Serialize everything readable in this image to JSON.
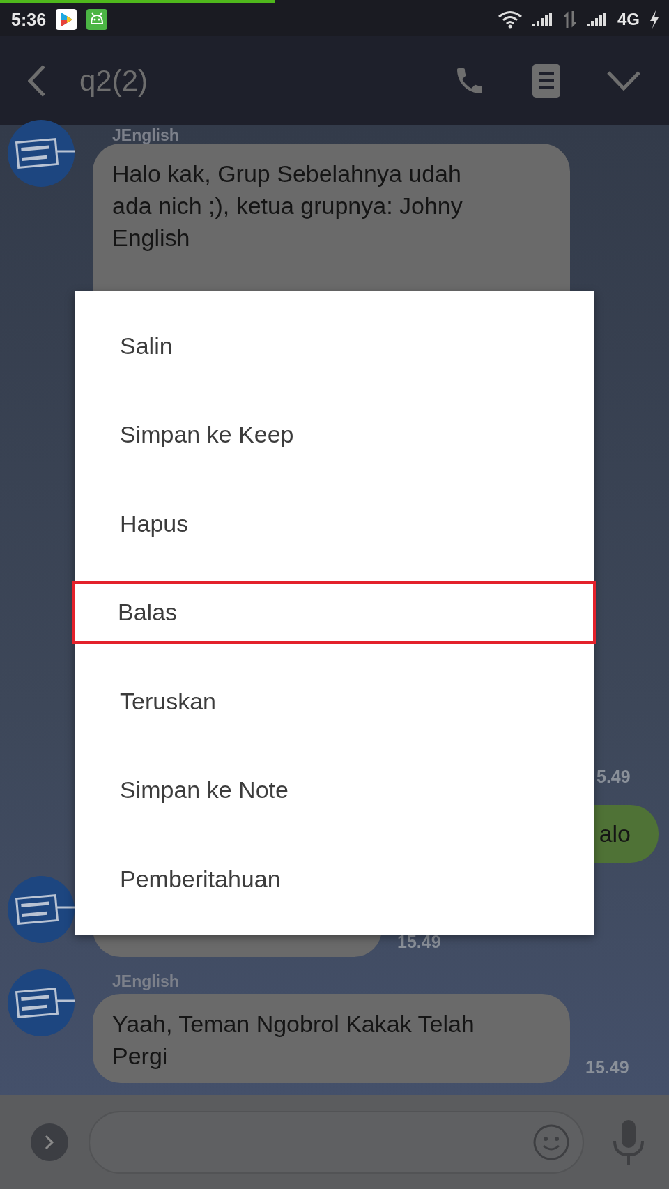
{
  "progress": {
    "level": 0.41
  },
  "status_bar": {
    "time": "5:36",
    "network": "4G"
  },
  "header": {
    "title": "q2(2)"
  },
  "chat": [
    {
      "kind": "incoming",
      "sender": "JEnglish",
      "text": "Halo kak, Grup Sebelahnya udah ada nich ;), ketua grupnya: Johny English"
    },
    {
      "kind": "time",
      "time": "5.49"
    },
    {
      "kind": "outgoing",
      "text": "alo"
    },
    {
      "kind": "covered",
      "time": "15.49"
    },
    {
      "kind": "incoming",
      "sender": "JEnglish",
      "text": "Yaah, Teman Ngobrol Kakak Telah Pergi",
      "time": "15.49"
    }
  ],
  "menu": [
    {
      "label": "Salin",
      "selected": false
    },
    {
      "label": "Simpan ke Keep",
      "selected": false
    },
    {
      "label": "Hapus",
      "selected": false
    },
    {
      "label": "Balas",
      "selected": true
    },
    {
      "label": "Teruskan",
      "selected": false
    },
    {
      "label": "Simpan ke Note",
      "selected": false
    },
    {
      "label": "Pemberitahuan",
      "selected": false
    }
  ]
}
